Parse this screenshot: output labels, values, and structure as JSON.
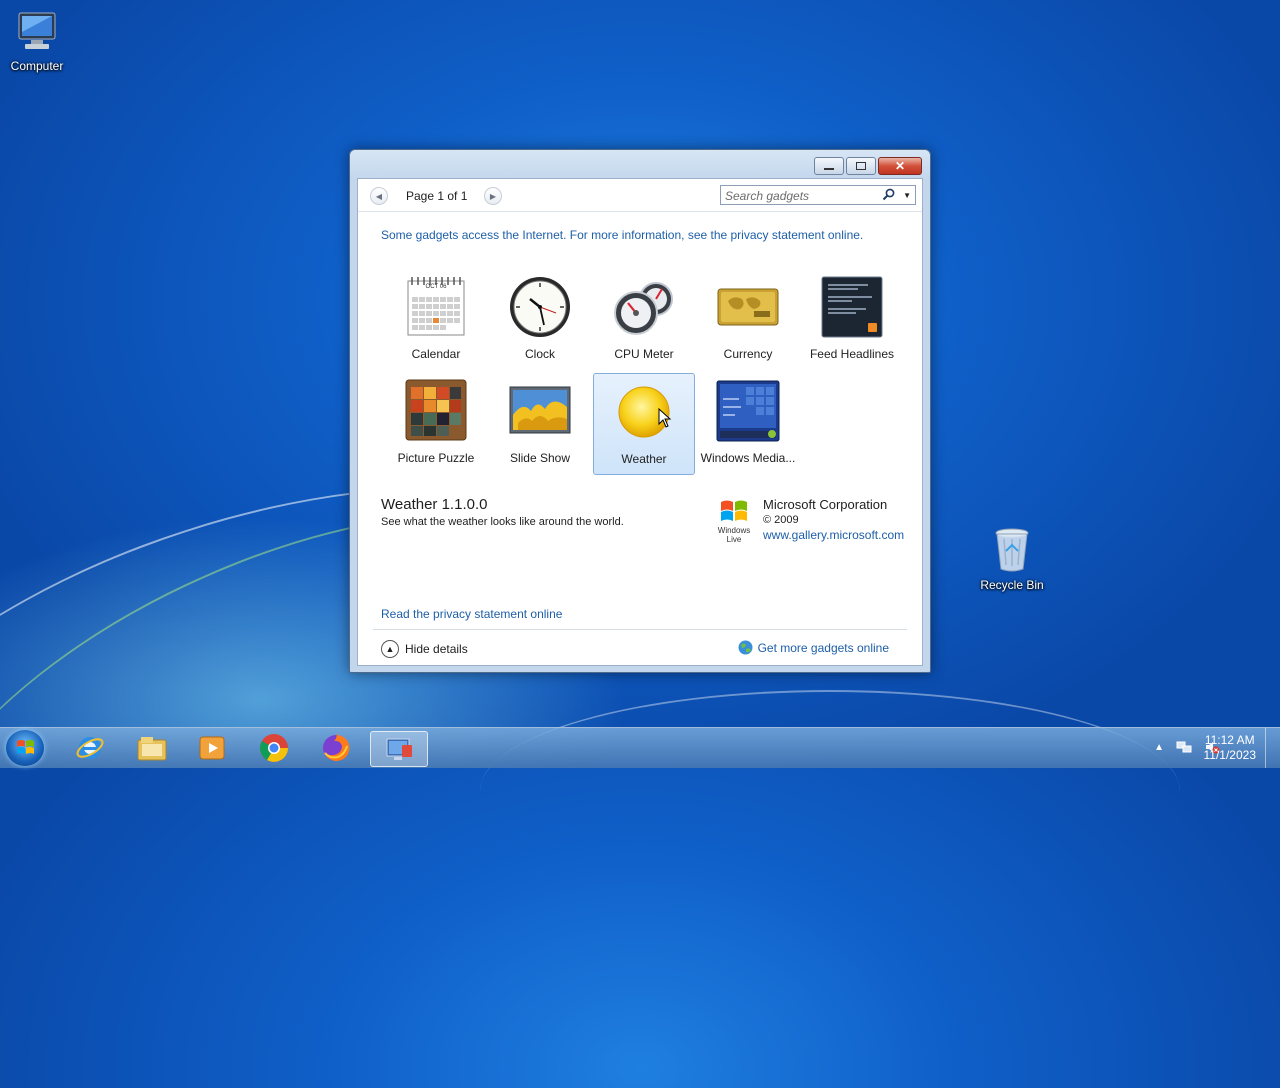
{
  "desktop": {
    "icons": [
      {
        "label": "Computer"
      },
      {
        "label": "Recycle Bin"
      }
    ]
  },
  "window": {
    "toolbar": {
      "page_label": "Page 1 of 1",
      "search_placeholder": "Search gadgets"
    },
    "notice": "Some gadgets access the Internet.  For more information, see the privacy statement online.",
    "gadgets": [
      {
        "label": "Calendar",
        "icon": "calendar-icon"
      },
      {
        "label": "Clock",
        "icon": "clock-icon"
      },
      {
        "label": "CPU Meter",
        "icon": "cpu-meter-icon"
      },
      {
        "label": "Currency",
        "icon": "currency-icon"
      },
      {
        "label": "Feed Headlines",
        "icon": "feed-headlines-icon"
      },
      {
        "label": "Picture Puzzle",
        "icon": "picture-puzzle-icon"
      },
      {
        "label": "Slide Show",
        "icon": "slide-show-icon"
      },
      {
        "label": "Weather",
        "icon": "weather-icon",
        "selected": true
      },
      {
        "label": "Windows Media...",
        "icon": "windows-media-icon"
      }
    ],
    "details": {
      "title": "Weather 1.1.0.0",
      "description": "See what the weather looks like around the world.",
      "logo_text": "Windows Live",
      "company": "Microsoft Corporation",
      "year": "© 2009",
      "url": "www.gallery.microsoft.com"
    },
    "privacy_link": "Read the privacy statement online",
    "footer": {
      "hide_details": "Hide details",
      "get_more": "Get more gadgets online"
    }
  },
  "calendar_thumb": {
    "month": "OCT 06"
  },
  "taskbar": {
    "apps": [
      "internet-explorer-icon",
      "file-explorer-icon",
      "media-player-icon",
      "chrome-icon",
      "firefox-icon",
      "gadgets-icon"
    ],
    "clock": {
      "time": "11:12 AM",
      "date": "11/1/2023"
    }
  },
  "colors": {
    "link": "#1e5fa8",
    "selection": "#cfe4fa",
    "desktop": "#0f5fc8"
  }
}
